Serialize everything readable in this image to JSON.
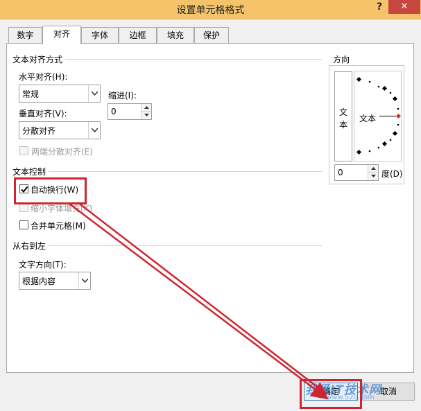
{
  "window": {
    "title": "设置单元格格式",
    "help": "?",
    "close": "✕"
  },
  "tabs": [
    "数字",
    "对齐",
    "字体",
    "边框",
    "填充",
    "保护"
  ],
  "alignment": {
    "section_title": "文本对齐方式",
    "horizontal_label": "水平对齐(H):",
    "horizontal_value": "常规",
    "indent_label": "缩进(I):",
    "indent_value": "0",
    "vertical_label": "垂直对齐(V):",
    "vertical_value": "分散对齐",
    "justify_distributed_label": "两端分散对齐(E)"
  },
  "text_control": {
    "section_title": "文本控制",
    "wrap_text_label": "自动换行(W)",
    "wrap_text_checked": true,
    "shrink_to_fit_label": "缩小字体填充(K)",
    "merge_cells_label": "合并单元格(M)"
  },
  "rtl": {
    "section_title": "从右到左",
    "direction_label": "文字方向(T):",
    "direction_value": "根据内容"
  },
  "orientation": {
    "section_title": "方向",
    "vertical_text": [
      "文",
      "本"
    ],
    "dial_text": "文本",
    "degree_value": "0",
    "degree_label": "度(D)"
  },
  "buttons": {
    "ok": "确定",
    "cancel": "取消"
  },
  "watermark": {
    "main": "我爱IT技术网",
    "sub": "www.52ij.com"
  },
  "colors": {
    "highlight": "#d1242f",
    "titlebar": "#f5c46a",
    "close": "#c7463e"
  }
}
